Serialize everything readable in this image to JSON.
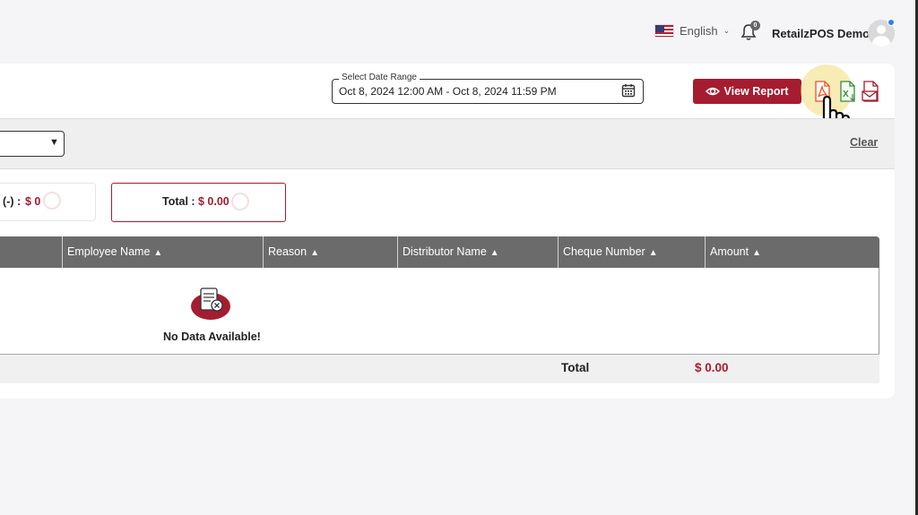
{
  "header": {
    "language": "English",
    "notifications_count": "0",
    "user_name": "RetailzPOS Demo"
  },
  "filters": {
    "date_range_label": "Select Date Range",
    "date_range_value": "Oct 8, 2024 12:00 AM - Oct 8, 2024 11:59 PM",
    "view_report_label": "View Report",
    "clear_label": "Clear"
  },
  "summary": {
    "item1_label": "(-) :",
    "item1_value": "$ 0",
    "total_label": "Total :",
    "total_value": "$ 0.00"
  },
  "table": {
    "columns": [
      "Employee Name",
      "Reason",
      "Distributor Name",
      "Cheque Number",
      "Amount"
    ],
    "empty_message": "No Data Available!",
    "footer_label": "Total",
    "footer_value": "$ 0.00"
  },
  "colors": {
    "accent": "#a51c30",
    "header_bg": "#6b6b6b"
  },
  "icons": {
    "export": [
      "pdf-export-icon",
      "excel-export-icon",
      "email-export-icon"
    ]
  }
}
